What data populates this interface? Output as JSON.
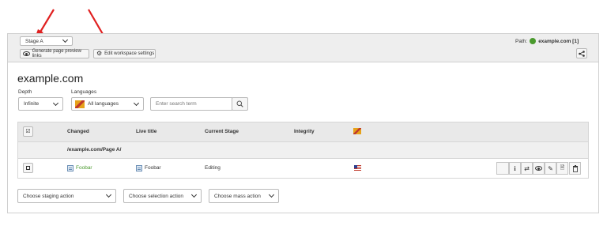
{
  "toolbar": {
    "stage_select": "Stage A",
    "preview_links_label": "Generate page preview links",
    "workspace_settings_label": "Edit workspace settings",
    "path_label": "Path:",
    "path_value": "example.com [1]"
  },
  "page_title": "example.com",
  "filters": {
    "depth_label": "Depth",
    "depth_value": "Infinite",
    "languages_label": "Languages",
    "languages_value": "All languages",
    "search_placeholder": "Enter search term"
  },
  "table": {
    "columns": [
      "Changed",
      "Live title",
      "Current Stage",
      "Integrity"
    ],
    "group_label": "/example.com/Page A/",
    "rows": [
      {
        "changed": "Foobar",
        "live_title": "Foobar",
        "stage": "Editing"
      }
    ]
  },
  "actions": {
    "staging": "Choose staging action",
    "selection": "Choose selection action",
    "mass": "Choose mass action"
  },
  "colors": {
    "accent_green": "#4a9a2e",
    "arrow_red": "#e02020"
  }
}
